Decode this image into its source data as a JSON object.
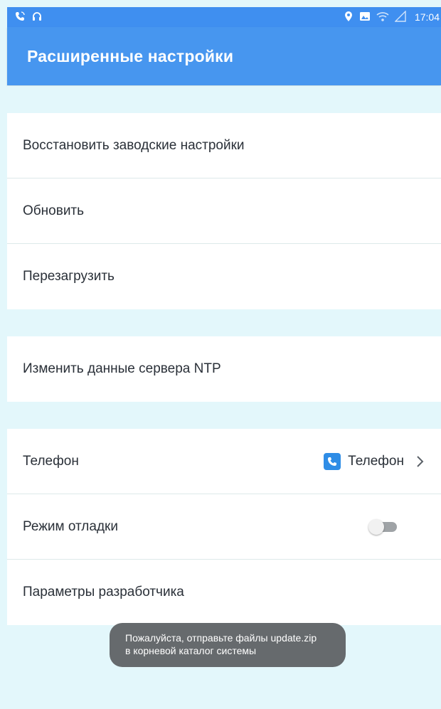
{
  "status_bar": {
    "time": "17:04",
    "left_icons": [
      "phone-call-icon",
      "headset-icon"
    ],
    "right_icons": [
      "location-pin-icon",
      "gallery-icon",
      "wifi-icon",
      "signal-icon"
    ]
  },
  "app_bar": {
    "title": "Расширенные настройки"
  },
  "sections": {
    "system": [
      {
        "label": "Восстановить заводские настройки"
      },
      {
        "label": "Обновить"
      },
      {
        "label": "Перезагрузить"
      }
    ],
    "ntp": [
      {
        "label": "Изменить данные сервера NTP"
      }
    ],
    "misc": {
      "phone": {
        "label": "Телефон",
        "value": "Телефон"
      },
      "debug": {
        "label": "Режим отладки",
        "enabled": false
      },
      "developer": {
        "label": "Параметры разработчика"
      }
    }
  },
  "toast": {
    "line1": "Пожалуйста, отправьте файлы update.zip",
    "line2": "в корневой каталог системы"
  },
  "colors": {
    "app_bar": "#4796ef",
    "status_bar": "#3f8ff0",
    "background": "#e3f7fb",
    "accent": "#2f8de6"
  }
}
